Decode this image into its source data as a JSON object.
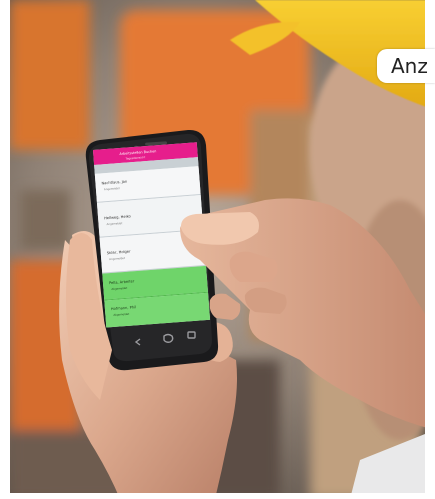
{
  "badge": {
    "label": "Anz"
  },
  "phone": {
    "header_title": "Arbeitsstellen Buchen",
    "header_sub": "Tagesübersicht",
    "items": [
      {
        "name": "Nachtlaus, Jan",
        "status": "Angemeldet"
      },
      {
        "name": "Hellweg, Heiko",
        "status": "Angemeldet"
      },
      {
        "name": "Stöhr, Holger",
        "status": "Angemeldet"
      },
      {
        "name": "Pella, Arbeiter",
        "status": "Abgemeldet"
      },
      {
        "name": "Hofmann, Phil",
        "status": "Abgemeldet"
      }
    ]
  }
}
